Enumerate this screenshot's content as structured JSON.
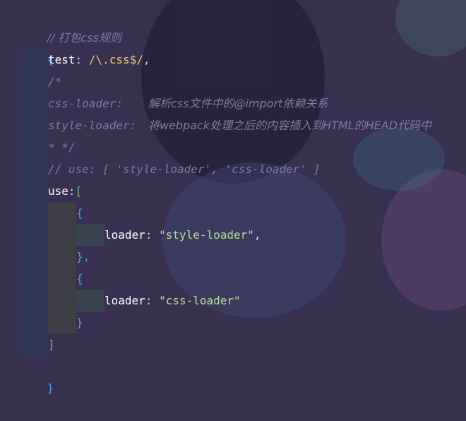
{
  "colors": {
    "background": "#37304f",
    "comment": "#7f7aa3",
    "string": "#b5e08a",
    "regex": "#f0c674",
    "brace": "#4aa0e0",
    "bracket": "#6ec28a"
  },
  "code": {
    "l1_comment": "// 打包css规则",
    "l2_open": "{",
    "l3_key": "test",
    "l3_colon": ": ",
    "l3_regex": "/\\.css$/",
    "l3_comma": ",",
    "l4_comment": "/*",
    "l5_key": "css-loader:",
    "l5_desc": "解析css文件中的@import依赖关系",
    "l6_key": "style-loader:",
    "l6_desc": "将webpack处理之后的内容插入到HTML的HEAD代码中",
    "l7_comment": "* */",
    "l8_comment": "// use: [ 'style-loader', 'css-loader' ]",
    "l9_key": "use",
    "l9_colon": ":",
    "l9_bracket": "[",
    "l10_brace": "{",
    "l11_key": "loader",
    "l11_colon": ": ",
    "l11_value": "\"style-loader\"",
    "l11_comma": ",",
    "l12_close": "},",
    "l13_brace": "{",
    "l14_key": "loader",
    "l14_colon": ": ",
    "l14_value": "\"css-loader\"",
    "l15_close": "}",
    "l16_bracket": "]",
    "l17_close": "}"
  }
}
